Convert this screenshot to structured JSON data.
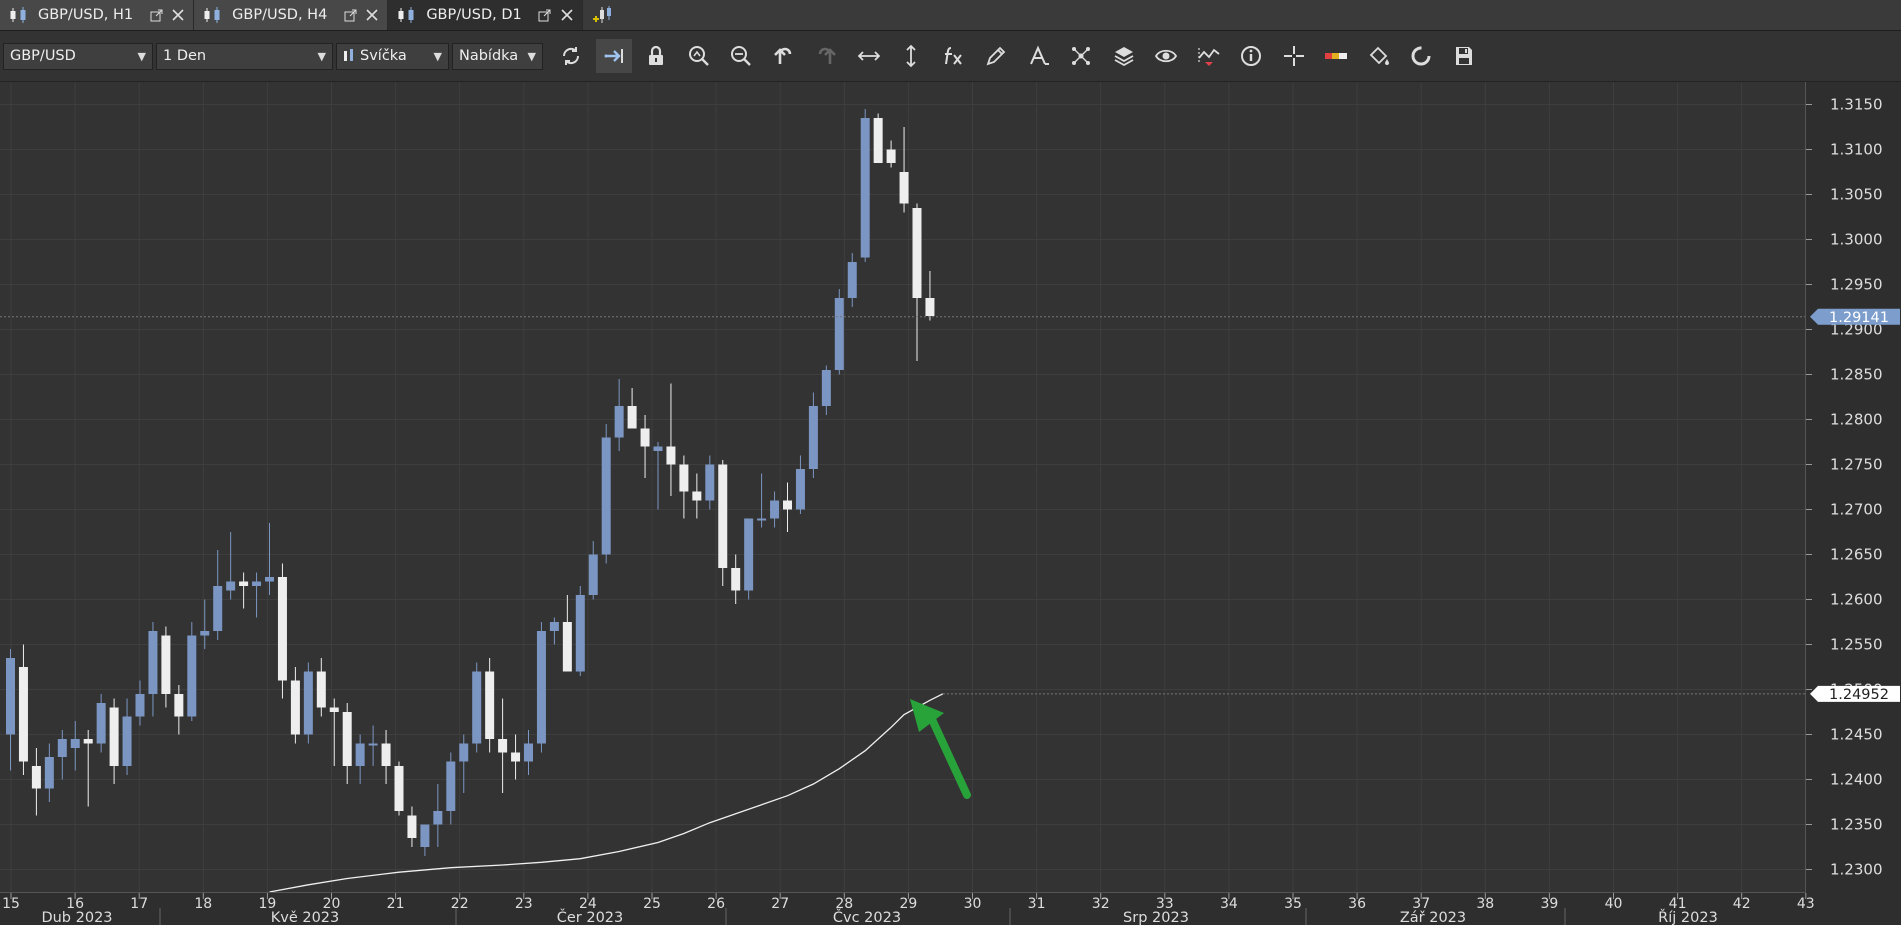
{
  "tabs": [
    {
      "label": "GBP/USD, H1",
      "active": false
    },
    {
      "label": "GBP/USD, H4",
      "active": false
    },
    {
      "label": "GBP/USD, D1",
      "active": true
    }
  ],
  "toolbar": {
    "symbol": "GBP/USD",
    "period": "1 Den",
    "chart_type": "Svíčka",
    "price_side": "Nabídka",
    "tools": [
      "refresh-icon",
      "auto-scroll-icon",
      "lock-icon",
      "zoom-in-icon",
      "zoom-out-icon",
      "undo-icon",
      "redo-icon",
      "horizontal-scale-icon",
      "vertical-scale-icon",
      "indicators-fx-icon",
      "pencil-icon",
      "text-icon",
      "objects-icon",
      "layers-icon",
      "eye-icon",
      "chart-signals-icon",
      "info-icon",
      "crosshair-icon",
      "color-bar-icon",
      "paint-bucket-icon",
      "reload-icon",
      "save-icon"
    ],
    "active_tool": "auto-scroll-icon"
  },
  "colors": {
    "background": "#333333",
    "bull": "#7b96c2",
    "bear": "#eeeeee",
    "grid": "#3e3e3e",
    "price_marker": "#7d9ecd",
    "arrow": "#27a33a"
  },
  "chart_data": {
    "type": "candlestick",
    "symbol": "GBP/USD",
    "timeframe": "D1",
    "ylim": [
      1.2275,
      1.3175
    ],
    "y_ticks": [
      "1.2300",
      "1.2350",
      "1.2400",
      "1.2450",
      "1.2500",
      "1.2550",
      "1.2600",
      "1.2650",
      "1.2700",
      "1.2750",
      "1.2800",
      "1.2850",
      "1.2900",
      "1.2950",
      "1.3000",
      "1.3050",
      "1.3100",
      "1.3150"
    ],
    "week_ticks": [
      "15",
      "16",
      "17",
      "18",
      "19",
      "20",
      "21",
      "22",
      "23",
      "24",
      "25",
      "26",
      "27",
      "28",
      "29",
      "30",
      "31",
      "32",
      "33",
      "34",
      "35",
      "36",
      "37",
      "38",
      "39",
      "40",
      "41",
      "42",
      "43"
    ],
    "month_labels": [
      "Dub 2023",
      "Kvě 2023",
      "Čer 2023",
      "Čvc 2023",
      "Srp 2023",
      "Zář 2023",
      "Říj 2023"
    ],
    "current_price": "1.29141",
    "line_value": "1.24952",
    "candles": [
      [
        1.245,
        1.2545,
        1.241,
        1.2535
      ],
      [
        1.2525,
        1.255,
        1.2405,
        1.242
      ],
      [
        1.2415,
        1.2435,
        1.236,
        1.239
      ],
      [
        1.239,
        1.244,
        1.2375,
        1.2425
      ],
      [
        1.2425,
        1.2455,
        1.24,
        1.2445
      ],
      [
        1.2435,
        1.2465,
        1.241,
        1.2445
      ],
      [
        1.2445,
        1.2455,
        1.237,
        1.244
      ],
      [
        1.244,
        1.2495,
        1.243,
        1.2485
      ],
      [
        1.248,
        1.249,
        1.2395,
        1.2415
      ],
      [
        1.2415,
        1.249,
        1.2405,
        1.247
      ],
      [
        1.247,
        1.251,
        1.246,
        1.2495
      ],
      [
        1.2495,
        1.2575,
        1.247,
        1.2565
      ],
      [
        1.256,
        1.257,
        1.248,
        1.2495
      ],
      [
        1.2495,
        1.2505,
        1.245,
        1.247
      ],
      [
        1.247,
        1.2575,
        1.2465,
        1.256
      ],
      [
        1.256,
        1.26,
        1.2545,
        1.2565
      ],
      [
        1.2565,
        1.2655,
        1.2555,
        1.2615
      ],
      [
        1.261,
        1.2675,
        1.26,
        1.262
      ],
      [
        1.262,
        1.263,
        1.259,
        1.2615
      ],
      [
        1.2615,
        1.263,
        1.258,
        1.262
      ],
      [
        1.262,
        1.2685,
        1.2605,
        1.2625
      ],
      [
        1.2625,
        1.264,
        1.249,
        1.251
      ],
      [
        1.251,
        1.2525,
        1.244,
        1.245
      ],
      [
        1.245,
        1.253,
        1.244,
        1.252
      ],
      [
        1.252,
        1.2535,
        1.247,
        1.248
      ],
      [
        1.248,
        1.249,
        1.2415,
        1.2475
      ],
      [
        1.2475,
        1.2485,
        1.2395,
        1.2415
      ],
      [
        1.2415,
        1.245,
        1.2395,
        1.244
      ],
      [
        1.244,
        1.246,
        1.2415,
        1.244
      ],
      [
        1.244,
        1.2455,
        1.2395,
        1.2415
      ],
      [
        1.2415,
        1.242,
        1.236,
        1.2365
      ],
      [
        1.236,
        1.237,
        1.2325,
        1.2335
      ],
      [
        1.2325,
        1.235,
        1.2315,
        1.235
      ],
      [
        1.235,
        1.2395,
        1.2325,
        1.2365
      ],
      [
        1.2365,
        1.243,
        1.235,
        1.242
      ],
      [
        1.242,
        1.245,
        1.2385,
        1.244
      ],
      [
        1.244,
        1.253,
        1.243,
        1.252
      ],
      [
        1.252,
        1.2535,
        1.243,
        1.2445
      ],
      [
        1.2445,
        1.249,
        1.2385,
        1.243
      ],
      [
        1.243,
        1.245,
        1.24,
        1.242
      ],
      [
        1.242,
        1.2455,
        1.2405,
        1.244
      ],
      [
        1.244,
        1.2575,
        1.243,
        1.2565
      ],
      [
        1.2565,
        1.258,
        1.255,
        1.2575
      ],
      [
        1.2575,
        1.2605,
        1.254,
        1.252
      ],
      [
        1.252,
        1.2615,
        1.2515,
        1.2605
      ],
      [
        1.2605,
        1.2665,
        1.26,
        1.265
      ],
      [
        1.265,
        1.2795,
        1.264,
        1.278
      ],
      [
        1.278,
        1.2845,
        1.2765,
        1.2815
      ],
      [
        1.2815,
        1.2835,
        1.279,
        1.279
      ],
      [
        1.279,
        1.2805,
        1.2735,
        1.277
      ],
      [
        1.2765,
        1.2775,
        1.27,
        1.277
      ],
      [
        1.277,
        1.284,
        1.2715,
        1.275
      ],
      [
        1.275,
        1.276,
        1.269,
        1.272
      ],
      [
        1.272,
        1.274,
        1.269,
        1.271
      ],
      [
        1.271,
        1.276,
        1.27,
        1.275
      ],
      [
        1.275,
        1.2755,
        1.2615,
        1.2635
      ],
      [
        1.2635,
        1.265,
        1.2595,
        1.261
      ],
      [
        1.261,
        1.269,
        1.26,
        1.269
      ],
      [
        1.269,
        1.274,
        1.268,
        1.269
      ],
      [
        1.269,
        1.272,
        1.268,
        1.271
      ],
      [
        1.271,
        1.273,
        1.2675,
        1.27
      ],
      [
        1.27,
        1.276,
        1.2695,
        1.2745
      ],
      [
        1.2745,
        1.283,
        1.2735,
        1.2815
      ],
      [
        1.2815,
        1.286,
        1.2805,
        1.2855
      ],
      [
        1.2855,
        1.2945,
        1.285,
        1.2935
      ],
      [
        1.2935,
        1.2985,
        1.2925,
        1.2975
      ],
      [
        1.298,
        1.3145,
        1.2975,
        1.3135
      ],
      [
        1.3135,
        1.314,
        1.3085,
        1.3085
      ],
      [
        1.31,
        1.311,
        1.308,
        1.3085
      ],
      [
        1.3075,
        1.3125,
        1.303,
        1.304
      ],
      [
        1.3035,
        1.304,
        1.2865,
        1.2935
      ],
      [
        1.2935,
        1.2965,
        1.291,
        1.2915
      ]
    ],
    "line_points": [
      [
        20,
        1.2275
      ],
      [
        23,
        1.2283
      ],
      [
        26,
        1.229
      ],
      [
        30,
        1.2297
      ],
      [
        34,
        1.2302
      ],
      [
        38,
        1.2305
      ],
      [
        41,
        1.2308
      ],
      [
        44,
        1.2312
      ],
      [
        47,
        1.232
      ],
      [
        50,
        1.233
      ],
      [
        52,
        1.234
      ],
      [
        54,
        1.2352
      ],
      [
        56,
        1.2362
      ],
      [
        58,
        1.2372
      ],
      [
        60,
        1.2382
      ],
      [
        62,
        1.2395
      ],
      [
        64,
        1.2412
      ],
      [
        66,
        1.2432
      ],
      [
        68,
        1.2458
      ],
      [
        69,
        1.2472
      ],
      [
        71,
        1.2488
      ],
      [
        72,
        1.24952
      ]
    ]
  }
}
